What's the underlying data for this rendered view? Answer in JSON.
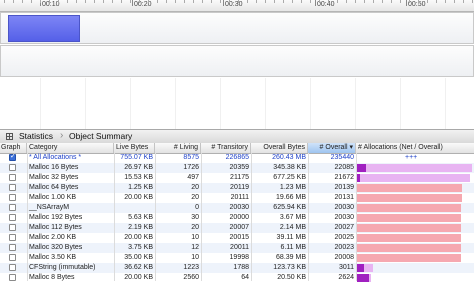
{
  "timeline": {
    "labels": [
      "00:10",
      "00:20",
      "00:30",
      "00:40",
      "00:50",
      "01:00",
      "01:10"
    ]
  },
  "toolbar": {
    "crumb1": "Statistics",
    "crumb2": "Object Summary"
  },
  "columns": {
    "graph": "Graph",
    "category": "Category",
    "live_bytes": "Live Bytes",
    "living": "# Living",
    "transitory": "# Transitory",
    "overall_bytes": "Overall Bytes",
    "overall": "# Overall ▾",
    "allocations": "# Allocations (Net / Overall)"
  },
  "rows": [
    {
      "checked": true,
      "category": "* All Allocations *",
      "live_bytes": "755.07 KB",
      "living": "8575",
      "transitory": "226865",
      "overall_bytes": "260.43 MB",
      "overall": "235440",
      "net_fraction": 0,
      "overall_fraction": 0,
      "highlight": true,
      "plus": "+++"
    },
    {
      "checked": false,
      "category": "Malloc 16 Bytes",
      "live_bytes": "26.97 KB",
      "living": "1726",
      "transitory": "20359",
      "overall_bytes": "345.38 KB",
      "overall": "22085",
      "net_fraction": 0.08,
      "overall_fraction": 1.0
    },
    {
      "checked": false,
      "category": "Malloc 32 Bytes",
      "live_bytes": "15.53 KB",
      "living": "497",
      "transitory": "21175",
      "overall_bytes": "677.25 KB",
      "overall": "21672",
      "net_fraction": 0.03,
      "overall_fraction": 0.98
    },
    {
      "checked": false,
      "category": "Malloc 64 Bytes",
      "live_bytes": "1.25 KB",
      "living": "20",
      "transitory": "20119",
      "overall_bytes": "1.23 MB",
      "overall": "20139",
      "net_fraction": 0,
      "overall_fraction": 0.91
    },
    {
      "checked": false,
      "category": "Malloc 1.00 KB",
      "live_bytes": "20.00 KB",
      "living": "20",
      "transitory": "20111",
      "overall_bytes": "19.66 MB",
      "overall": "20131",
      "net_fraction": 0,
      "overall_fraction": 0.91
    },
    {
      "checked": false,
      "category": "__NSArrayM",
      "live_bytes": "",
      "living": "0",
      "transitory": "20030",
      "overall_bytes": "625.94 KB",
      "overall": "20030",
      "net_fraction": 0,
      "overall_fraction": 0.9
    },
    {
      "checked": false,
      "category": "Malloc 192 Bytes",
      "live_bytes": "5.63 KB",
      "living": "30",
      "transitory": "20000",
      "overall_bytes": "3.67 MB",
      "overall": "20030",
      "net_fraction": 0,
      "overall_fraction": 0.9
    },
    {
      "checked": false,
      "category": "Malloc 112 Bytes",
      "live_bytes": "2.19 KB",
      "living": "20",
      "transitory": "20007",
      "overall_bytes": "2.14 MB",
      "overall": "20027",
      "net_fraction": 0,
      "overall_fraction": 0.9
    },
    {
      "checked": false,
      "category": "Malloc 2.00 KB",
      "live_bytes": "20.00 KB",
      "living": "10",
      "transitory": "20015",
      "overall_bytes": "39.11 MB",
      "overall": "20025",
      "net_fraction": 0,
      "overall_fraction": 0.9
    },
    {
      "checked": false,
      "category": "Malloc 320 Bytes",
      "live_bytes": "3.75 KB",
      "living": "12",
      "transitory": "20011",
      "overall_bytes": "6.11 MB",
      "overall": "20023",
      "net_fraction": 0,
      "overall_fraction": 0.9
    },
    {
      "checked": false,
      "category": "Malloc 3.50 KB",
      "live_bytes": "35.00 KB",
      "living": "10",
      "transitory": "19998",
      "overall_bytes": "68.39 MB",
      "overall": "20008",
      "net_fraction": 0,
      "overall_fraction": 0.9
    },
    {
      "checked": false,
      "category": "CFString (immutable)",
      "live_bytes": "36.62 KB",
      "living": "1223",
      "transitory": "1788",
      "overall_bytes": "123.73 KB",
      "overall": "3011",
      "net_fraction": 0.06,
      "overall_fraction": 0.14
    },
    {
      "checked": false,
      "category": "Malloc 8 Bytes",
      "live_bytes": "20.00 KB",
      "living": "2560",
      "transitory": "64",
      "overall_bytes": "20.50 KB",
      "overall": "2624",
      "net_fraction": 0.1,
      "overall_fraction": 0.12
    }
  ],
  "colors": {
    "selection_segment": "#5d66ee",
    "net_bar": "#a020c0",
    "overall_bar_pink": "#f6a8b0",
    "overall_bar_lilac": "#e8b4f2",
    "sorted_header": "#b6d3f5",
    "blue_text": "#1c3fc8"
  }
}
